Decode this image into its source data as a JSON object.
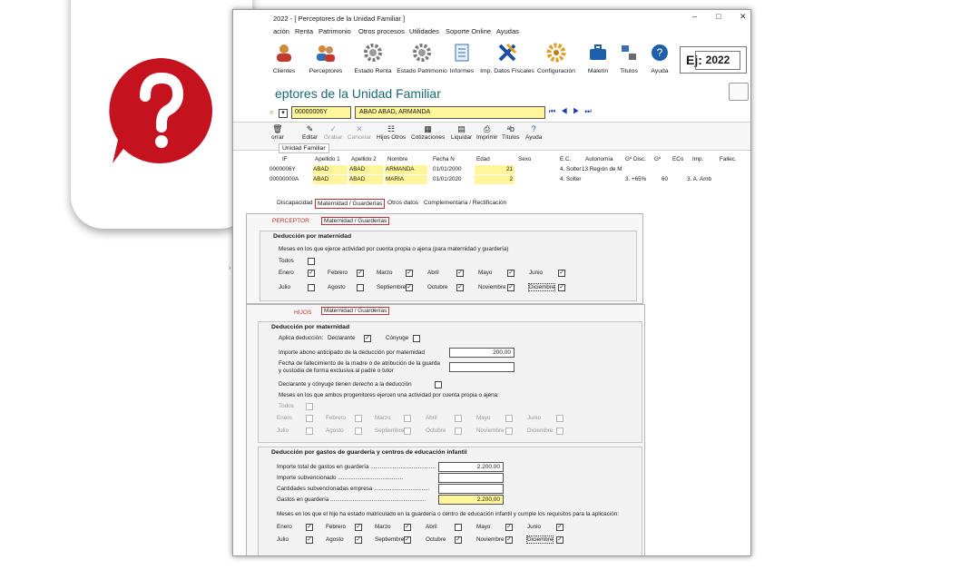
{
  "window": {
    "title": "2022 - [ Perceptores de la Unidad Familiar ]",
    "controls": {
      "minimize": "–",
      "maximize": "□",
      "close": "✕"
    }
  },
  "menu": [
    "ación",
    "Renta",
    "Patrimonio",
    "Otros procesos",
    "Utilidades",
    "Soporte Online",
    "Ayudas"
  ],
  "toolbar": {
    "items": [
      {
        "label": "Clientes",
        "icon": "user-icon"
      },
      {
        "label": "Perceptores",
        "icon": "users-icon"
      },
      {
        "label": "Estado Renta",
        "icon": "gear-ren-icon"
      },
      {
        "label": "Estado Patrimonio",
        "icon": "gear-pat-icon"
      },
      {
        "label": "Informes",
        "icon": "document-icon"
      },
      {
        "label": "Imp. Datos Fiscales",
        "icon": "import-icon"
      },
      {
        "label": "Configuración",
        "icon": "settings-icon"
      },
      {
        "label": "Maletín",
        "icon": "briefcase-icon"
      },
      {
        "label": "Titulos",
        "icon": "titles-icon"
      },
      {
        "label": "Ayuda",
        "icon": "help-icon"
      }
    ],
    "ej_label": "Ej:",
    "year": "2022"
  },
  "page_title": "eptores de la Unidad Familiar",
  "selector": {
    "nif": "00000006Y",
    "name": "ABAD ABAD, ARMANDA"
  },
  "actions": [
    {
      "label": "orrar",
      "glyph": "🗑",
      "enabled": true
    },
    {
      "label": "Editar",
      "glyph": "✎",
      "enabled": true
    },
    {
      "label": "Grabar",
      "glyph": "✓",
      "enabled": false
    },
    {
      "label": "Cancelar",
      "glyph": "✕",
      "enabled": false
    },
    {
      "label": "Hijos Otros",
      "glyph": "☷",
      "enabled": true
    },
    {
      "label": "Cotizaciones",
      "glyph": "▦",
      "enabled": true
    },
    {
      "label": "Liquidar",
      "glyph": "▤",
      "enabled": true
    },
    {
      "label": "Imprimir",
      "glyph": "⎙",
      "enabled": true
    },
    {
      "label": "Títulos",
      "glyph": "ᵃb",
      "enabled": true
    },
    {
      "label": "Ayuda",
      "glyph": "?",
      "enabled": true
    }
  ],
  "subtab_label": "Unidad Familiar",
  "grid": {
    "headers": [
      "IF",
      "Apellido 1",
      "Apellido 2",
      "Nombre",
      "Fecha N",
      "Edad",
      "Sexo",
      "E.C.",
      "Autonomía",
      "Gº Disc.",
      "Gº",
      "ECo",
      "Imp.",
      "Fallec."
    ],
    "rows": [
      [
        "0000006Y",
        "ABAD",
        "ABAD",
        "ARMANDA",
        "01/01/2000",
        "21",
        "",
        "4. Solter",
        "13 Región de M",
        "",
        "",
        "",
        "",
        ""
      ],
      [
        "00000000A",
        "ABAD",
        "ABAD",
        "MARIA",
        "01/01/2020",
        "2",
        "",
        "4. Solter",
        "",
        "3. +65%",
        "60",
        "",
        "3. A. Amb",
        ""
      ]
    ]
  },
  "tabs": [
    "Discapacidad",
    "Maternidad / Guarderías",
    "Otros datos",
    "Complementaria / Rectificación"
  ],
  "perceptor": {
    "head": "PERCEPTOR",
    "tab": "Maternidad / Guarderías",
    "group_title": "Deducción por maternidad",
    "months_label": "Meses en los que ejerce actividad por cuenta propia o ajena (para maternidad y guardería)",
    "todos_label": "Todos",
    "months": [
      {
        "name": "Enero",
        "checked": true
      },
      {
        "name": "Febrero",
        "checked": true
      },
      {
        "name": "Marzo",
        "checked": true
      },
      {
        "name": "Abril",
        "checked": true
      },
      {
        "name": "Mayo",
        "checked": true
      },
      {
        "name": "Junio",
        "checked": true
      },
      {
        "name": "Julio",
        "checked": false
      },
      {
        "name": "Agosto",
        "checked": false
      },
      {
        "name": "Septiembre",
        "checked": true
      },
      {
        "name": "Octubre",
        "checked": true
      },
      {
        "name": "Noviembre",
        "checked": true
      },
      {
        "name": "Diciembre",
        "checked": true
      }
    ]
  },
  "hijos": {
    "head": "HIJOS",
    "tab": "Maternidad / Guarderías",
    "mat_title": "Deducción por maternidad",
    "aplica_label": "Aplica deducción:",
    "declarante_label": "Declarante",
    "conyuge_label": "Cónyuge",
    "importe_label": "Importe abono anticipado de la deducción por maternidad",
    "importe_value": "200,00",
    "fecha_label_1": "Fecha de fallecimiento de la madre o de atribución de la guarda",
    "fecha_label_2": "y custodia de forma exclusiva al padre o tutor",
    "derecho_label": "Declarante y cónyuge tienen derecho a la deducción",
    "meses_label": "Meses en los que ambos progenitores ejercen una actividad por cuenta propia o ajena:",
    "todos_label": "Todos",
    "months_dis": [
      "Enero",
      "Febrero",
      "Marzo",
      "Abril",
      "Mayo",
      "Junio",
      "Julio",
      "Agosto",
      "Septiembre",
      "Octubre",
      "Noviembre",
      "Diciembre"
    ],
    "guard_title": "Deducción por gastos de guardería y centros de educación infantil",
    "importe_total_label": "Importe total de gastos en guardería .........................................",
    "importe_total_value": "2.200,00",
    "subvencionado_label": "Importe subvencionado .........................................",
    "cantidades_label": "Cantidades subvencionadas empresa ...................................",
    "gastos_label": "Gastos en guardería ............................................................",
    "gastos_value": "2.200,00",
    "matric_label": "Meses en los que el hijo ha estado matriculado en la guardería o centro de educación infantil y cumple los requisitos para la aplicación:",
    "months": [
      {
        "name": "Enero",
        "checked": true
      },
      {
        "name": "Febrero",
        "checked": true
      },
      {
        "name": "Marzo",
        "checked": true
      },
      {
        "name": "Abril",
        "checked": false
      },
      {
        "name": "Mayo",
        "checked": true
      },
      {
        "name": "Junio",
        "checked": true
      },
      {
        "name": "Julio",
        "checked": true
      },
      {
        "name": "Agosto",
        "checked": true
      },
      {
        "name": "Septiembre",
        "checked": true
      },
      {
        "name": "Octubre",
        "checked": true
      },
      {
        "name": "Noviembre",
        "checked": true
      },
      {
        "name": "Diciembre",
        "checked": true
      }
    ]
  },
  "colors": {
    "accent_teal": "#196a73",
    "highlight_yellow": "#fff59a",
    "red_tab": "#c03030",
    "badge_red": "#c4121f"
  }
}
